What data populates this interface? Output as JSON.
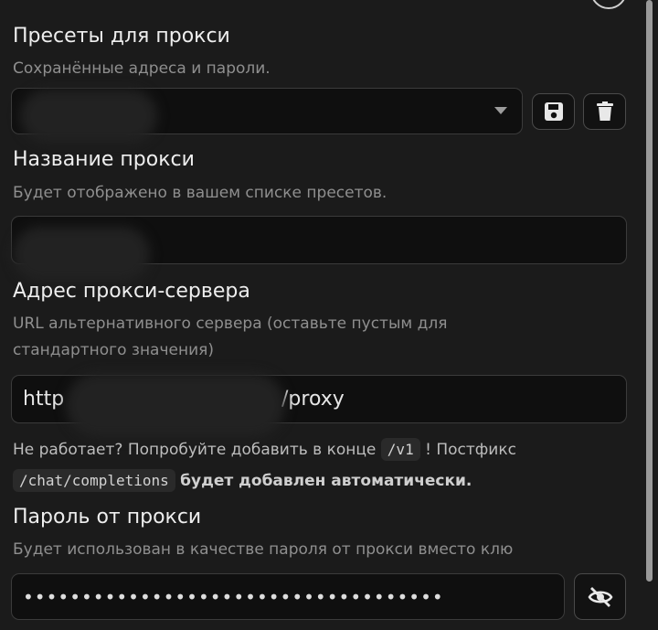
{
  "presets": {
    "title": "Пресеты для прокси",
    "hint": "Сохранённые адреса и пароли.",
    "selected": "",
    "save_icon": "floppy-disk-icon",
    "delete_icon": "trash-icon"
  },
  "name": {
    "title": "Название прокси",
    "hint": "Будет отображено в вашем списке пресетов.",
    "value": ""
  },
  "address": {
    "title": "Адрес прокси-сервера",
    "hint_line1": "URL альтернативного сервера (оставьте пустым для",
    "hint_line2": "стандартного значения)",
    "value_prefix": "http",
    "value_suffix": "/proxy",
    "note_part1": "Не работает? Попробуйте добавить в конце",
    "note_code1": "/v1",
    "note_part2": "! Постфикс",
    "note_code2": "/chat/completions",
    "note_bold": "будет добавлен автоматически."
  },
  "password": {
    "title": "Пароль от прокси",
    "hint": "Будет использован в качестве пароля от прокси вместо клю",
    "value": "••••••••••••••••••••••••••••••••••••",
    "toggle_icon": "eye-slash-icon"
  }
}
